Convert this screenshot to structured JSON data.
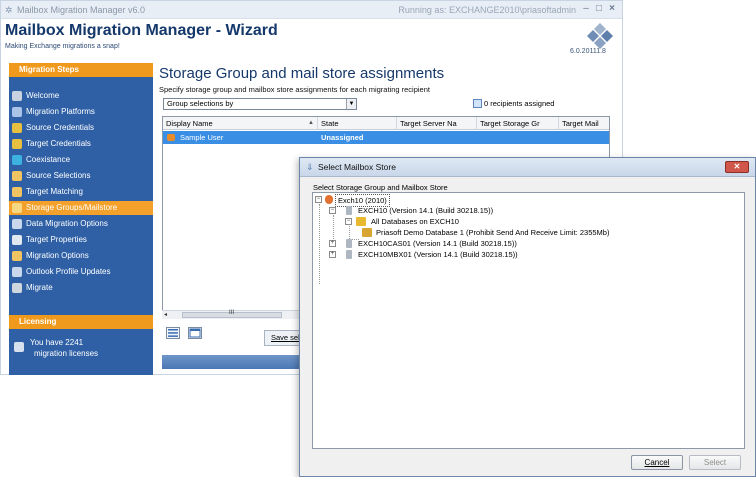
{
  "window": {
    "title": "Mailbox Migration Manager v6.0",
    "running_as": "Running as: EXCHANGE2010\\priasoftadmin",
    "min": "–",
    "max": "□",
    "close": "×"
  },
  "header": {
    "title": "Mailbox Migration Manager - Wizard",
    "subtitle": "Making Exchange migrations a snap!",
    "version": "6.0.20111.8"
  },
  "sidebar": {
    "steps_heading": "Migration Steps",
    "items": [
      {
        "label": "Welcome",
        "icon": "welcome-icon",
        "color": "#c9d2e0"
      },
      {
        "label": "Migration Platforms",
        "icon": "platforms-icon",
        "color": "#a9c4e6"
      },
      {
        "label": "Source Credentials",
        "icon": "key-icon",
        "color": "#e8c040"
      },
      {
        "label": "Target Credentials",
        "icon": "key-icon",
        "color": "#e8c040"
      },
      {
        "label": "Coexistance",
        "icon": "globe-icon",
        "color": "#3db1e0"
      },
      {
        "label": "Source Selections",
        "icon": "selections-icon",
        "color": "#f0c460"
      },
      {
        "label": "Target Matching",
        "icon": "matching-icon",
        "color": "#f0c460"
      },
      {
        "label": "Storage Groups/Mailstore",
        "icon": "storage-icon",
        "color": "#f7d780",
        "active": true
      },
      {
        "label": "Data Migration Options",
        "icon": "data-icon",
        "color": "#c9d8ec"
      },
      {
        "label": "Target Properties",
        "icon": "properties-icon",
        "color": "#e2e8f0"
      },
      {
        "label": "Migration Options",
        "icon": "options-icon",
        "color": "#f0c460"
      },
      {
        "label": "Outlook Profile Updates",
        "icon": "outlook-icon",
        "color": "#c9d8ec"
      },
      {
        "label": "Migrate",
        "icon": "migrate-icon",
        "color": "#d0d6de"
      }
    ],
    "licensing_heading": "Licensing",
    "license_line1": "You have 2241",
    "license_line2": "migration licenses"
  },
  "panel": {
    "title": "Storage Group and mail store assignments",
    "subtitle": "Specify storage group and mailbox store assignments for each migrating recipient",
    "combo_value": "Group selections by",
    "recipients": "0 recipients assigned",
    "columns": [
      "Display Name",
      "State",
      "Target Server Na",
      "Target Storage Gr",
      "Target Mail"
    ],
    "rows": [
      {
        "display_name": "Sample User",
        "state": "Unassigned"
      }
    ],
    "scroll_left": "◂",
    "scroll_dots": "III",
    "save_label": "Save sel"
  },
  "dialog": {
    "title": "Select Mailbox Store",
    "close_label": "✕",
    "label": "Select Storage Group and Mailbox Store",
    "tree": {
      "root": "Exch10 (2010)",
      "server1": "EXCH10 (Version 14.1 (Build 30218.15))",
      "all_db": "All Databases on EXCH10",
      "db1": "Priasoft Demo Database 1 (Prohibit Send And Receive Limit: 2355Mb)",
      "server2": "EXCH10CAS01 (Version 14.1 (Build 30218.15))",
      "server3": "EXCH10MBX01 (Version 14.1 (Build 30218.15))"
    },
    "cancel_label": "Cancel",
    "select_label": "Select"
  },
  "colors": {
    "sidebar_bg": "#2f60a6",
    "accent_orange": "#f09a1d",
    "selection_blue": "#3a8fe4",
    "title_blue": "#15386b"
  }
}
